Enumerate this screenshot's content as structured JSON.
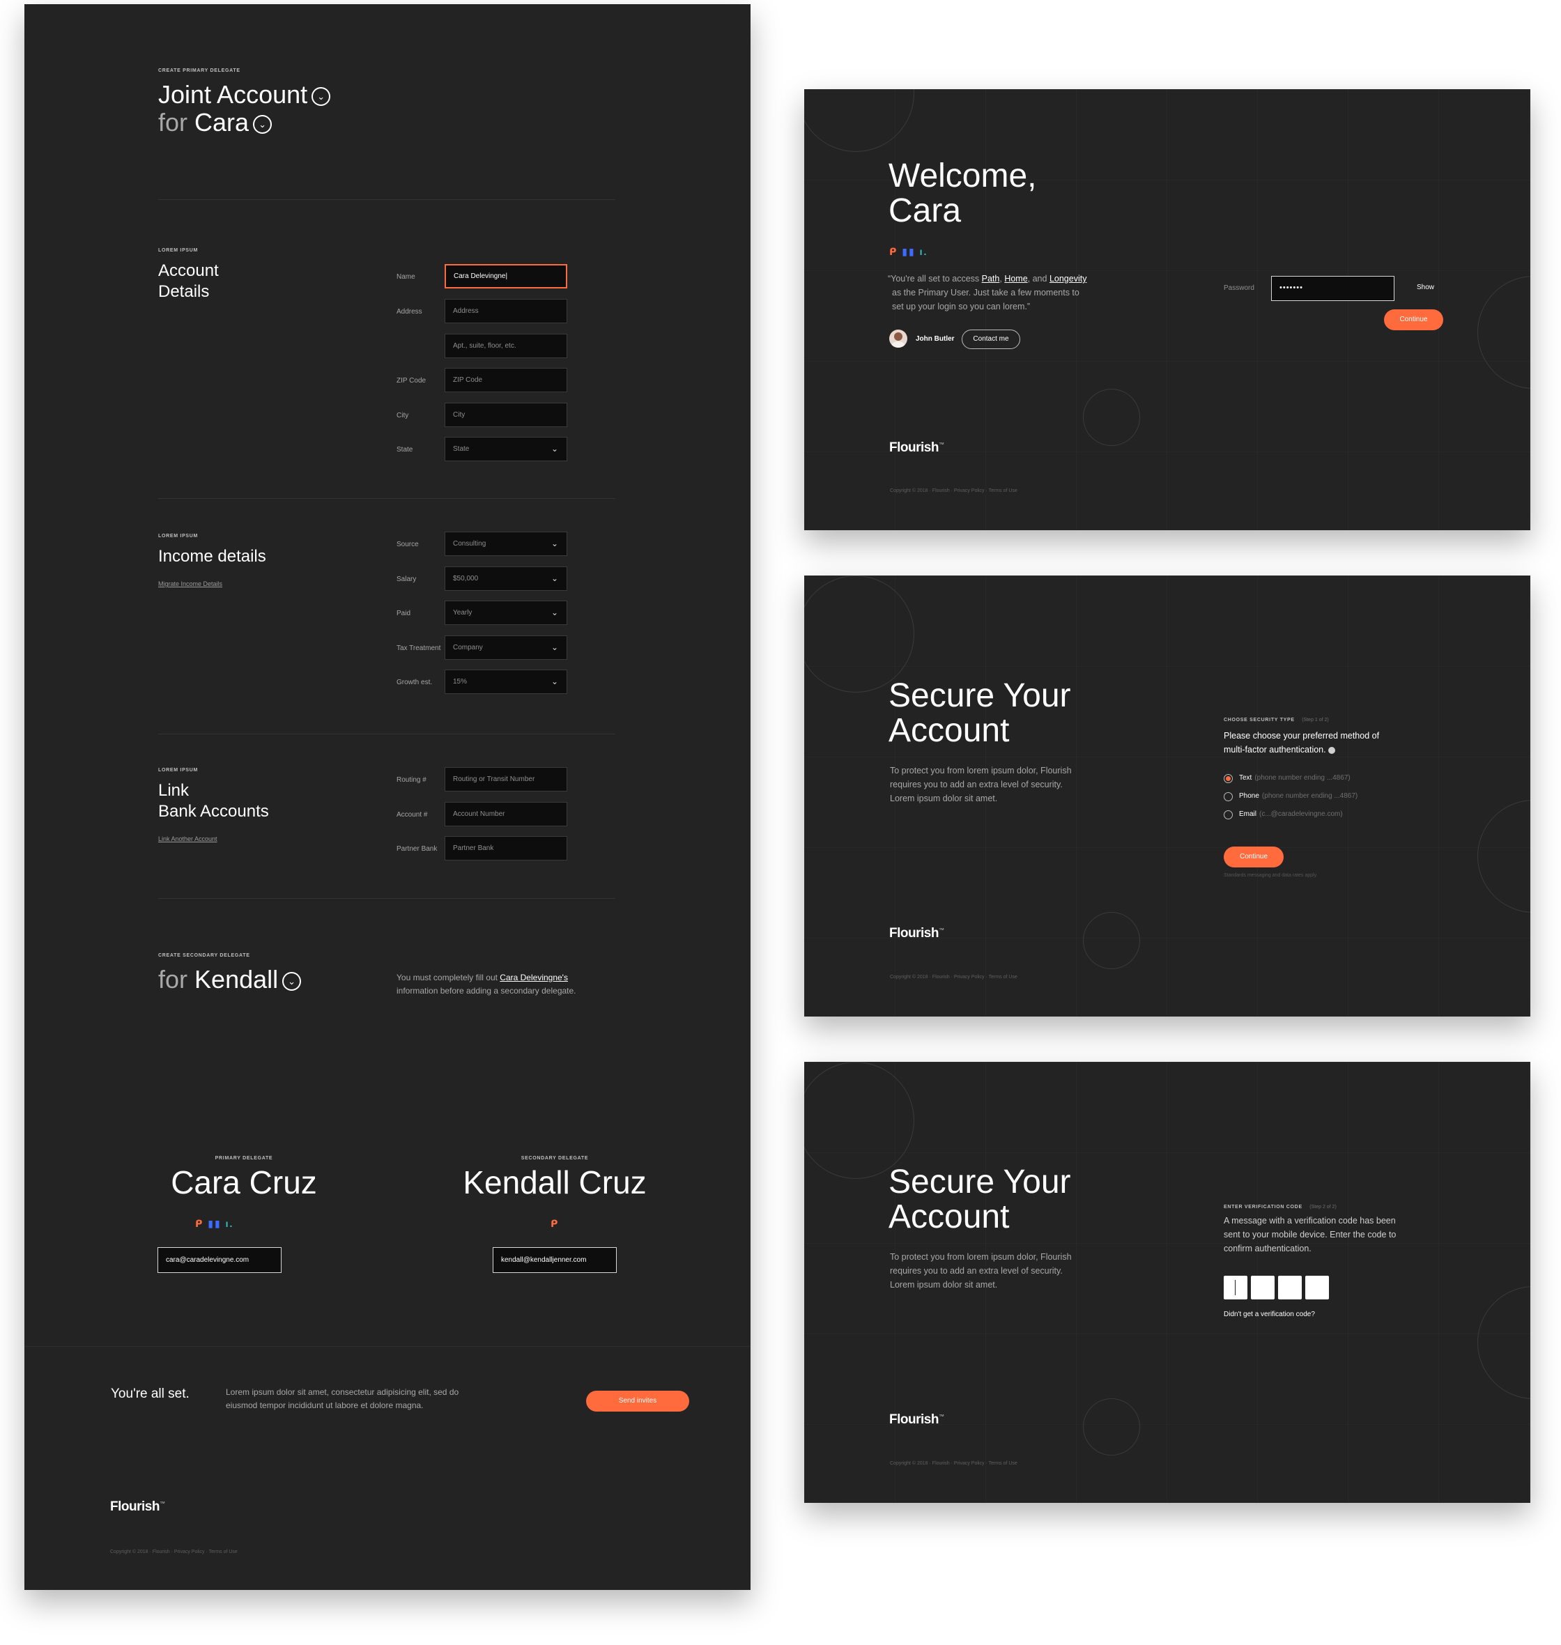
{
  "left": {
    "eyebrow": "CREATE PRIMARY DELEGATE",
    "title_line1": "Joint Account",
    "title_line2_prefix": "for",
    "title_line2_name": "Cara",
    "chevron": "⌄",
    "account_section": {
      "eyebrow": "LOREM IPSUM",
      "title_line1": "Account",
      "title_line2": "Details",
      "fields": [
        {
          "label": "Name",
          "value": "Cara Delevingne|"
        },
        {
          "label": "Address",
          "value": "Address"
        },
        {
          "label": "",
          "value": "Apt., suite, floor, etc."
        },
        {
          "label": "ZIP Code",
          "value": "ZIP Code"
        },
        {
          "label": "City",
          "value": "City"
        },
        {
          "label": "State",
          "value": "State"
        }
      ]
    },
    "income_section": {
      "eyebrow": "LOREM IPSUM",
      "title": "Income details",
      "link": "Migrate Income Details",
      "fields": [
        {
          "label": "Source",
          "value": "Consulting"
        },
        {
          "label": "Salary",
          "value": "$50,000"
        },
        {
          "label": "Paid",
          "value": "Yearly"
        },
        {
          "label": "Tax Treatment",
          "value": "Company"
        },
        {
          "label": "Growth est.",
          "value": "15%"
        }
      ]
    },
    "bank_section": {
      "eyebrow": "LOREM IPSUM",
      "title_line1": "Link",
      "title_line2": "Bank Accounts",
      "link": "Link Another Account",
      "fields": [
        {
          "label": "Routing #",
          "value": "Routing or Transit Number"
        },
        {
          "label": "Account #",
          "value": "Account Number"
        },
        {
          "label": "Partner Bank",
          "value": "Partner Bank"
        }
      ]
    },
    "secondary": {
      "eyebrow": "CREATE SECONDARY DELEGATE",
      "title_prefix": "for",
      "title_name": "Kendall",
      "note_before": "You must completely fill out ",
      "note_link": "Cara Delevingne's",
      "note_after": "information before adding a secondary delegate."
    },
    "primary_card": {
      "eyebrow": "PRIMARY DELEGATE",
      "name": "Cara Cruz",
      "email": "cara@caradelevingne.com"
    },
    "secondary_card": {
      "eyebrow": "SECONDARY DELEGATE",
      "name": "Kendall Cruz",
      "email": "kendall@kendalljenner.com"
    },
    "footer": {
      "title": "You're all set.",
      "text_line1": "Lorem ipsum dolor sit amet, consectetur adipisicing elit, sed do",
      "text_line2": "eiusmod tempor incididunt ut labore et dolore magna.",
      "button": "Send invites",
      "logo": "Flourish",
      "logo_mark": "™",
      "copyright": "Copyright © 2018 · Flourish · Privacy Policy · Terms of Use"
    }
  },
  "welcome": {
    "title_line1": "Welcome,",
    "title_line2": "Cara",
    "quote_before": "“You're all set to access ",
    "link_path": "Path",
    "comma1": ", ",
    "link_home": "Home",
    "and": ", and ",
    "link_longevity": "Longevity",
    "quote_line2": "as the Primary User. Just take a few moments to",
    "quote_line3": "set up your login so you can lorem.”",
    "advisor_name": "John Butler",
    "contact_button": "Contact me",
    "password_label": "Password",
    "password_value": "•••••••",
    "show_label": "Show",
    "continue": "Continue",
    "logo": "Flourish",
    "logo_mark": "™",
    "copyright": "Copyright © 2018 · Flourish · Privacy Policy · Terms of Use"
  },
  "secure1": {
    "title_line1": "Secure Your",
    "title_line2": "Account",
    "body_line1": "To protect you from lorem ipsum dolor, Flourish",
    "body_line2": "requires you to add an extra level of security.",
    "body_line3": "Lorem ipsum dolor sit amet.",
    "eyebrow": "CHOOSE SECURITY TYPE",
    "step": "(Step 1 of 2)",
    "prompt_line1": "Please choose your preferred method of",
    "prompt_line2": "multi-factor authentication.",
    "options": [
      {
        "label": "Text",
        "hint": "(phone number ending ...4867)"
      },
      {
        "label": "Phone",
        "hint": "(phone number ending ...4867)"
      },
      {
        "label": "Email",
        "hint": "(c...@caradelevingne.com)"
      }
    ],
    "continue": "Continue",
    "disclaimer": "Standards messaging and data rates apply.",
    "logo": "Flourish",
    "logo_mark": "™",
    "copyright": "Copyright © 2018 · Flourish · Privacy Policy · Terms of Use"
  },
  "secure2": {
    "title_line1": "Secure Your",
    "title_line2": "Account",
    "body_line1": "To protect you from lorem ipsum dolor, Flourish",
    "body_line2": "requires you to add an extra level of security.",
    "body_line3": "Lorem ipsum dolor sit amet.",
    "eyebrow": "ENTER VERIFICATION CODE",
    "step": "(Step 2 of 2)",
    "msg_line1": "A message with a verification code has been",
    "msg_line2": "sent to your mobile device. Enter the code to",
    "msg_line3": "confirm authentication.",
    "resend": "Didn't get a verification code?",
    "logo": "Flourish",
    "logo_mark": "™",
    "copyright": "Copyright © 2018 · Flourish · Privacy Policy · Terms of Use"
  },
  "colors": {
    "panel": "#232323",
    "accent": "#ff6b3d",
    "accent_blue": "#3d6bff",
    "accent_teal": "#33c2c8"
  },
  "icons": {
    "chevron": "chevron-down-icon",
    "brand_marks": [
      "path-mark-icon",
      "home-mark-icon",
      "longevity-mark-icon"
    ],
    "glyph_path": "ᑭ",
    "glyph_home": "▮▮",
    "glyph_longevity": "ı."
  }
}
